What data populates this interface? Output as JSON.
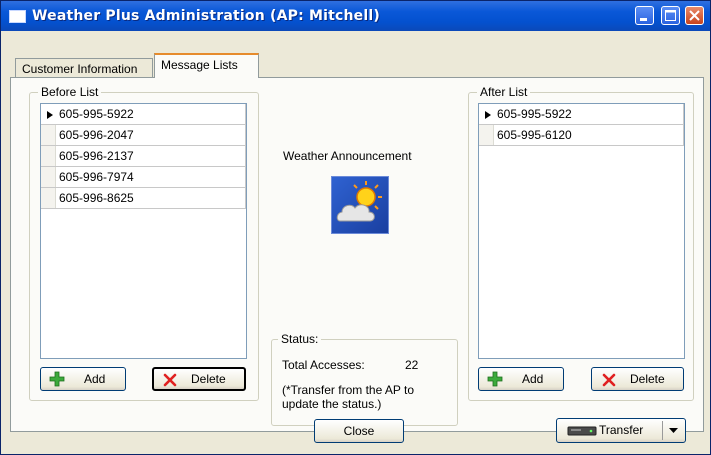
{
  "window": {
    "title": "Weather Plus Administration (AP: Mitchell)",
    "icon": "window-icon",
    "controls": [
      "minimize-icon",
      "maximize-icon",
      "close-icon"
    ]
  },
  "tabs": [
    {
      "label": "Customer Information",
      "active": false
    },
    {
      "label": "Message Lists",
      "active": true
    }
  ],
  "before_list": {
    "label": "Before List",
    "items": [
      "605-995-5922",
      "605-996-2047",
      "605-996-2137",
      "605-996-7974",
      "605-996-8625"
    ],
    "selected_index": 0,
    "add_label": "Add",
    "delete_label": "Delete"
  },
  "middle": {
    "announcement_label": "Weather Announcement",
    "announcement_icon": "weather-sun-cloud-icon",
    "status": {
      "label": "Status:",
      "total_accesses_label": "Total Accesses:",
      "total_accesses_value": "22",
      "note_line1": "(*Transfer from the AP to",
      "note_line2": "update the status.)"
    }
  },
  "after_list": {
    "label": "After List",
    "items": [
      "605-995-5922",
      "605-995-6120"
    ],
    "selected_index": 0,
    "add_label": "Add",
    "delete_label": "Delete"
  },
  "footer": {
    "close_label": "Close",
    "transfer_label": "Transfer"
  },
  "colors": {
    "titlebar": "#0a58d8",
    "dialog_bg": "#ece9d8",
    "add_icon": "#3caa3c",
    "delete_icon": "#e02020"
  }
}
